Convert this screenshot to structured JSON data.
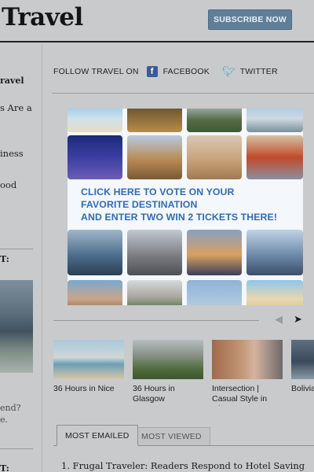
{
  "header": {
    "brand": "Travel",
    "subscribe_label": "SUBSCRIBE NOW"
  },
  "left_column": {
    "lines": [
      "ravel",
      "s Are a",
      "iness",
      "ood",
      "T:",
      "end?",
      "e.",
      "T:"
    ]
  },
  "follow": {
    "label": "FOLLOW TRAVEL ON",
    "facebook": "FACEBOOK",
    "twitter": "TWITTER"
  },
  "promo": {
    "line1": "CLICK HERE TO VOTE  ON YOUR",
    "line2": "FAVORITE DESTINATION",
    "line3": "AND ENTER TWO WIN 2 TICKETS THERE!"
  },
  "carousel": {
    "items": [
      {
        "caption": "36 Hours in Nice"
      },
      {
        "caption": "36 Hours in Glasgow"
      },
      {
        "caption": "Intersection | Casual Style in Glasgow"
      },
      {
        "caption": "Bolivia the Sky"
      }
    ]
  },
  "tabs": {
    "active": "MOST EMAILED",
    "inactive": "MOST VIEWED"
  },
  "list": {
    "first_item": "1.  Frugal Traveler: Readers Respond to Hotel Saving"
  },
  "icons": {
    "facebook": "facebook-icon",
    "twitter": "twitter-bird-icon",
    "prev": "chevron-left-icon",
    "next": "chevron-right-icon"
  },
  "colors": {
    "subscribe_bg": "#5f7f99",
    "promo_text": "#2f6cb3",
    "facebook": "#3c5a99",
    "twitter": "#3fa6d9"
  }
}
